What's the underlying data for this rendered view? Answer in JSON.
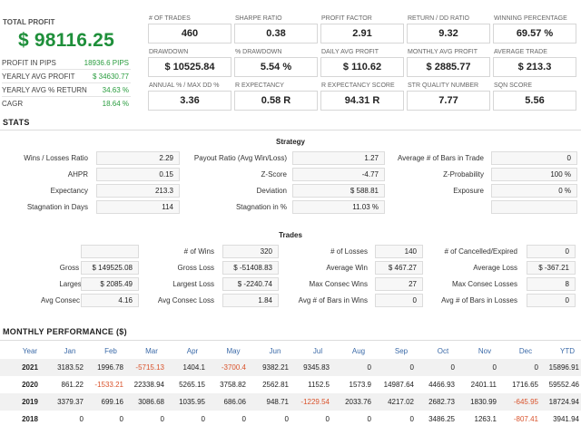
{
  "summary": {
    "total_label": "TOTAL PROFIT",
    "total_value": "$ 98116.25",
    "rows": [
      {
        "label": "PROFIT IN PIPS",
        "value": "18936.6 PIPS"
      },
      {
        "label": "YEARLY AVG PROFIT",
        "value": "$ 34630.77"
      },
      {
        "label": "YEARLY AVG % RETURN",
        "value": "34.63 %"
      },
      {
        "label": "CAGR",
        "value": "18.64 %"
      }
    ]
  },
  "metrics": [
    {
      "label": "# OF TRADES",
      "value": "460"
    },
    {
      "label": "SHARPE RATIO",
      "value": "0.38"
    },
    {
      "label": "PROFIT FACTOR",
      "value": "2.91"
    },
    {
      "label": "RETURN / DD RATIO",
      "value": "9.32"
    },
    {
      "label": "WINNING PERCENTAGE",
      "value": "69.57 %"
    },
    {
      "label": "DRAWDOWN",
      "value": "$ 10525.84"
    },
    {
      "label": "% DRAWDOWN",
      "value": "5.54 %"
    },
    {
      "label": "DAILY AVG PROFIT",
      "value": "$ 110.62"
    },
    {
      "label": "MONTHLY AVG PROFIT",
      "value": "$ 2885.77"
    },
    {
      "label": "AVERAGE TRADE",
      "value": "$ 213.3"
    },
    {
      "label": "ANNUAL % / MAX DD %",
      "value": "3.36"
    },
    {
      "label": "R EXPECTANCY",
      "value": "0.58 R"
    },
    {
      "label": "R EXPECTANCY SCORE",
      "value": "94.31 R"
    },
    {
      "label": "STR QUALITY NUMBER",
      "value": "7.77"
    },
    {
      "label": "SQN SCORE",
      "value": "5.56"
    }
  ],
  "stats": {
    "title": "STATS",
    "strategy": {
      "title": "Strategy",
      "rows": [
        [
          {
            "label": "Wins / Losses Ratio",
            "value": "2.29"
          },
          {
            "label": "Payout Ratio (Avg Win/Loss)",
            "value": "1.27"
          },
          {
            "label": "Average # of Bars in Trade",
            "value": "0"
          }
        ],
        [
          {
            "label": "AHPR",
            "value": "0.15"
          },
          {
            "label": "Z-Score",
            "value": "-4.77"
          },
          {
            "label": "Z-Probability",
            "value": "100 %"
          }
        ],
        [
          {
            "label": "Expectancy",
            "value": "213.3"
          },
          {
            "label": "Deviation",
            "value": "$ 588.81"
          },
          {
            "label": "Exposure",
            "value": "0 %"
          }
        ],
        [
          {
            "label": "Stagnation in Days",
            "value": "114"
          },
          {
            "label": "Stagnation in %",
            "value": "11.03 %"
          },
          {
            "label": "",
            "value": ""
          }
        ]
      ]
    },
    "trades": {
      "title": "Trades",
      "rows": [
        [
          {
            "label": "",
            "value": ""
          },
          {
            "label": "# of Wins",
            "value": "320"
          },
          {
            "label": "# of Losses",
            "value": "140"
          },
          {
            "label": "# of Cancelled/Expired",
            "value": "0"
          }
        ],
        [
          {
            "label": "Gross Profit",
            "value": "$ 149525.08"
          },
          {
            "label": "Gross Loss",
            "value": "$ -51408.83"
          },
          {
            "label": "Average Win",
            "value": "$ 467.27"
          },
          {
            "label": "Average Loss",
            "value": "$ -367.21"
          }
        ],
        [
          {
            "label": "Largest Win",
            "value": "$ 2085.49"
          },
          {
            "label": "Largest Loss",
            "value": "$ -2240.74"
          },
          {
            "label": "Max Consec Wins",
            "value": "27"
          },
          {
            "label": "Max Consec Losses",
            "value": "8"
          }
        ],
        [
          {
            "label": "Avg Consec Wins",
            "value": "4.16"
          },
          {
            "label": "Avg Consec Loss",
            "value": "1.84"
          },
          {
            "label": "Avg # of Bars in Wins",
            "value": "0"
          },
          {
            "label": "Avg # of Bars in Losses",
            "value": "0"
          }
        ]
      ]
    }
  },
  "monthly": {
    "title": "MONTHLY PERFORMANCE ($)",
    "headers": [
      "Year",
      "Jan",
      "Feb",
      "Mar",
      "Apr",
      "May",
      "Jun",
      "Jul",
      "Aug",
      "Sep",
      "Oct",
      "Nov",
      "Dec",
      "YTD"
    ],
    "rows": [
      {
        "year": "2021",
        "values": [
          "3183.52",
          "1996.78",
          "-5715.13",
          "1404.1",
          "-3700.4",
          "9382.21",
          "9345.83",
          "0",
          "0",
          "0",
          "0",
          "0",
          "15896.91"
        ]
      },
      {
        "year": "2020",
        "values": [
          "861.22",
          "-1533.21",
          "22338.94",
          "5265.15",
          "3758.82",
          "2562.81",
          "1152.5",
          "1573.9",
          "14987.64",
          "4466.93",
          "2401.11",
          "1716.65",
          "59552.46"
        ]
      },
      {
        "year": "2019",
        "values": [
          "3379.37",
          "699.16",
          "3086.68",
          "1035.95",
          "686.06",
          "948.71",
          "-1229.54",
          "2033.76",
          "4217.02",
          "2682.73",
          "1830.99",
          "-645.95",
          "18724.94"
        ]
      },
      {
        "year": "2018",
        "values": [
          "0",
          "0",
          "0",
          "0",
          "0",
          "0",
          "0",
          "0",
          "0",
          "3486.25",
          "1263.1",
          "-807.41",
          "3941.94"
        ]
      }
    ]
  },
  "colors": {
    "profit_green": "#1e8f3a",
    "negative": "#d9532c",
    "header_blue": "#3b6aa8"
  }
}
